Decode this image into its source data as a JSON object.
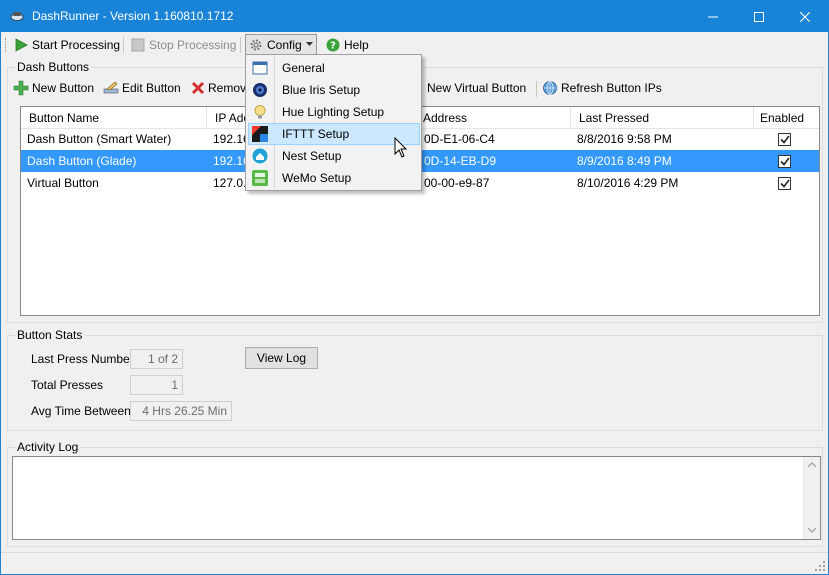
{
  "window": {
    "title": "DashRunner - Version 1.160810.1712",
    "icons": {
      "app": "dash-button-icon",
      "minimize": "minimize-icon",
      "maximize": "maximize-icon",
      "close": "close-icon"
    }
  },
  "toolbar": {
    "start_label": "Start Processing",
    "stop_label": "Stop Processing",
    "config_label": "Config",
    "help_label": "Help"
  },
  "config_menu": {
    "items": [
      {
        "label": "General",
        "icon": "window-icon"
      },
      {
        "label": "Blue Iris Setup",
        "icon": "blue-iris-icon"
      },
      {
        "label": "Hue Lighting Setup",
        "icon": "lightbulb-icon"
      },
      {
        "label": "IFTTT Setup",
        "icon": "ifttt-icon"
      },
      {
        "label": "Nest Setup",
        "icon": "nest-icon"
      },
      {
        "label": "WeMo Setup",
        "icon": "wemo-icon"
      }
    ],
    "highlighted": "IFTTT Setup"
  },
  "dash_buttons": {
    "group_label": "Dash Buttons",
    "actions": {
      "new": "New Button",
      "edit": "Edit Button",
      "remove": "Remov",
      "new_virtual": "New Virtual Button",
      "refresh": "Refresh Button IPs"
    },
    "columns": {
      "name": "Button Name",
      "ip": "IP Add",
      "mac": "Address",
      "last_pressed": "Last Pressed",
      "enabled": "Enabled"
    },
    "rows": [
      {
        "name": "Dash Button (Smart Water)",
        "ip": "192.16",
        "mac": "0D-E1-06-C4",
        "last_pressed": "8/8/2016 9:58 PM",
        "enabled": true
      },
      {
        "name": "Dash Button (Glade)",
        "ip": "192.16",
        "mac": "0D-14-EB-D9",
        "last_pressed": "8/9/2016 8:49 PM",
        "enabled": true
      },
      {
        "name": "Virtual Button",
        "ip": "127.0.0",
        "mac": "00-00-e9-87",
        "last_pressed": "8/10/2016 4:29 PM",
        "enabled": true
      }
    ],
    "selected_row": 1
  },
  "button_stats": {
    "group_label": "Button Stats",
    "last_press_number_label": "Last Press Number",
    "last_press_number_value": "1 of 2",
    "total_presses_label": "Total Presses",
    "total_presses_value": "1",
    "avg_time_label": "Avg Time Between",
    "avg_time_value": "4 Hrs 26.25 Min",
    "view_log_label": "View Log"
  },
  "activity_log": {
    "group_label": "Activity Log",
    "content": ""
  },
  "colors": {
    "titlebar": "#1883d7",
    "selection": "#3399ff",
    "menu_hover": "#cce8ff"
  }
}
